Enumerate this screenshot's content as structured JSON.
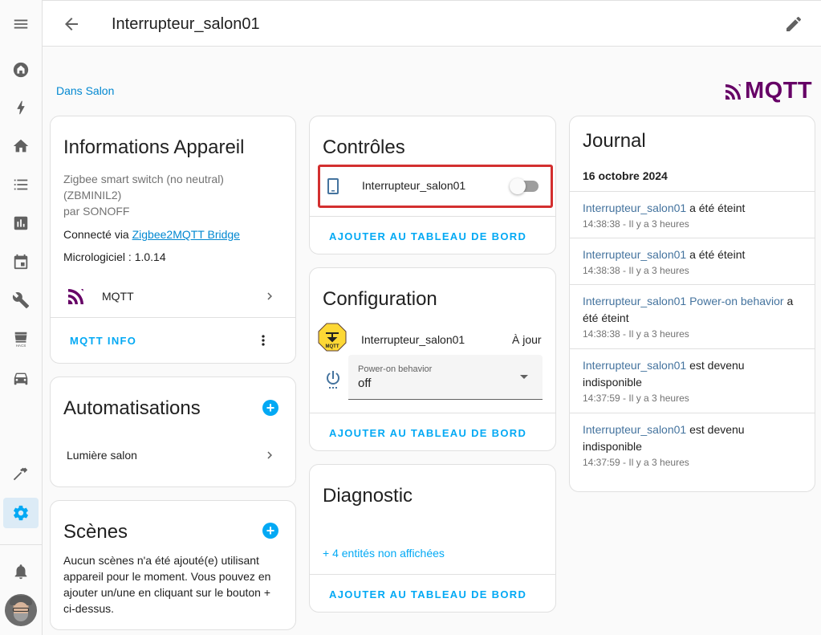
{
  "header": {
    "title": "Interrupteur_salon01"
  },
  "area_link": "Dans Salon",
  "brand": {
    "logo_text": "MQTT",
    "color": "#660066"
  },
  "sidebar": {
    "items": [
      {
        "name": "menu-icon"
      },
      {
        "name": "overview-icon"
      },
      {
        "name": "energy-icon"
      },
      {
        "name": "home-icon"
      },
      {
        "name": "logbook-icon"
      },
      {
        "name": "history-icon"
      },
      {
        "name": "calendar-icon"
      },
      {
        "name": "developer-tools-icon"
      },
      {
        "name": "hacs-icon",
        "label": "HACS"
      },
      {
        "name": "car-icon"
      },
      {
        "name": "hammer-icon"
      },
      {
        "name": "settings-icon",
        "active": true
      },
      {
        "name": "notifications-icon"
      }
    ],
    "accent": "#03a9f4"
  },
  "info_card": {
    "title": "Informations Appareil",
    "model": "Zigbee smart switch (no neutral)",
    "model_id": "(ZBMINIL2)",
    "manufacturer": "par SONOFF",
    "connected_prefix": "Connecté via ",
    "connected_link": "Zigbee2MQTT Bridge",
    "firmware": "Micrologiciel : 1.0.14",
    "integration": "MQTT",
    "action": "MQTT INFO"
  },
  "automations_card": {
    "title": "Automatisations",
    "items": [
      "Lumière salon"
    ]
  },
  "scenes_card": {
    "title": "Scènes",
    "text": "Aucun scènes n'a été ajouté(e) utilisant appareil pour le moment. Vous pouvez en ajouter un/une en cliquant sur le bouton + ci-dessus."
  },
  "controls_card": {
    "title": "Contrôles",
    "entity": "Interrupteur_salon01",
    "switch_state": "off",
    "action": "AJOUTER AU TABLEAU DE BORD"
  },
  "config_card": {
    "title": "Configuration",
    "entity": "Interrupteur_salon01",
    "entity_state": "À jour",
    "select_label": "Power-on behavior",
    "select_value": "off",
    "action": "AJOUTER AU TABLEAU DE BORD"
  },
  "diagnostic_card": {
    "title": "Diagnostic",
    "hidden_link": "+ 4 entités non affichées",
    "action": "AJOUTER AU TABLEAU DE BORD"
  },
  "journal_card": {
    "title": "Journal",
    "date": "16 octobre 2024",
    "entries": [
      {
        "link": "Interrupteur_salon01",
        "text": " a été éteint",
        "time": "14:38:38 - Il y a 3 heures"
      },
      {
        "link": "Interrupteur_salon01",
        "text": " a été éteint",
        "time": "14:38:38 - Il y a 3 heures"
      },
      {
        "link": "Interrupteur_salon01 Power-on behavior",
        "text": " a été éteint",
        "time": "14:38:38 - Il y a 3 heures"
      },
      {
        "link": "Interrupteur_salon01",
        "text": " est devenu indisponible",
        "time": "14:37:59 - Il y a 3 heures"
      },
      {
        "link": "Interrupteur_salon01",
        "text": " est devenu indisponible",
        "time": "14:37:59 - Il y a 3 heures"
      }
    ]
  }
}
